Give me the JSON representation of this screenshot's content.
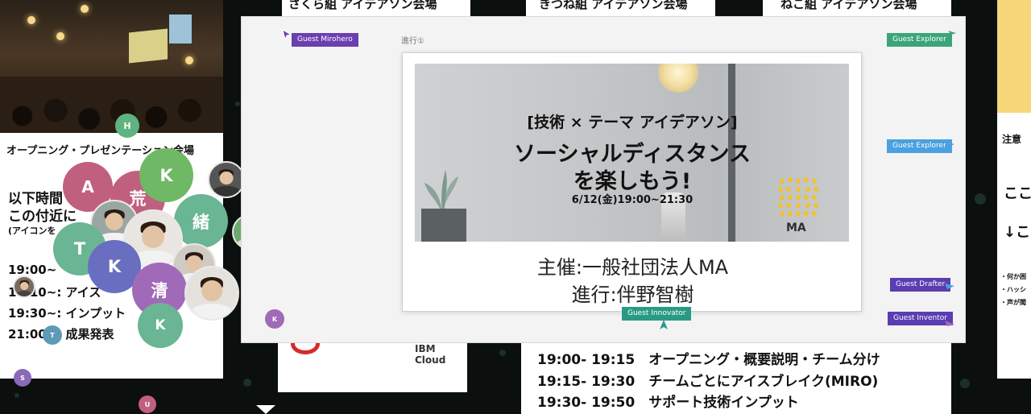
{
  "top_cards": [
    {
      "label": "さくら組 アイデアソン会場"
    },
    {
      "label": "きつね組 アイデアソン会場"
    },
    {
      "label": "ねこ組 アイデアソン会場"
    }
  ],
  "left_card": {
    "heading": "オープニング・プレゼンテーション会場",
    "lines": [
      "以下時間",
      "この付近に",
      "(アイコンを",
      "19:00~",
      "19:10~: アイス",
      "19:30~: インプット",
      "21:00~: 成果発表"
    ]
  },
  "avatars": [
    {
      "initial": "H",
      "color": "#5fb380"
    },
    {
      "initial": "A",
      "color": "#c0607e"
    },
    {
      "initial": "荒",
      "color": "#c0607e"
    },
    {
      "initial": "K",
      "color": "#6fb865"
    },
    {
      "initial": "緒",
      "color": "#6ab593"
    },
    {
      "initial": "T",
      "color": "#6ab593"
    },
    {
      "initial": "K",
      "color": "#6a6ec0"
    },
    {
      "initial": "清",
      "color": "#a06ab8"
    },
    {
      "initial": "K",
      "color": "#6ab593"
    },
    {
      "initial": "T",
      "color": "#5d9ab8"
    },
    {
      "initial": "S",
      "color": "#8a6ab8"
    },
    {
      "initial": "U",
      "color": "#c0607e"
    },
    {
      "initial": "K",
      "color": "#a06ab8"
    }
  ],
  "board": {
    "label": "進行①",
    "banner": {
      "line1": "[技術 × テーマ アイデアソン]",
      "line2": "ソーシャルディスタンス",
      "line3": "を楽しもう!",
      "date": "6/12(金)19:00~21:30",
      "logo_text": "MA"
    },
    "organizer": "主催:一般社団法人MA",
    "host": "進行:伴野智樹"
  },
  "guest_tags": [
    {
      "label": "Guest Mirohero",
      "color": "#6b3fb0"
    },
    {
      "label": "Guest Explorer",
      "color": "#3aa57a"
    },
    {
      "label": "Guest Explorer",
      "color": "#4aa0e0"
    },
    {
      "label": "Guest Drafter",
      "color": "#5a3db0"
    },
    {
      "label": "Guest Inventor",
      "color": "#5a3db0"
    },
    {
      "label": "Guest Innovator",
      "color": "#2a9a86"
    }
  ],
  "sponsor": {
    "label": "IBM Cloud"
  },
  "schedule": [
    "19:00- 19:15　オープニング・概要説明・チーム分け",
    "19:15- 19:30　チームごとにアイスブレイク(MIRO)",
    "19:30- 19:50　サポート技術インプット"
  ],
  "right_card": {
    "heading": "注意",
    "line1": "ここ",
    "line2": "↓こ",
    "bullets": [
      "・何か困",
      "・ハッシ",
      "・声が聞"
    ]
  }
}
